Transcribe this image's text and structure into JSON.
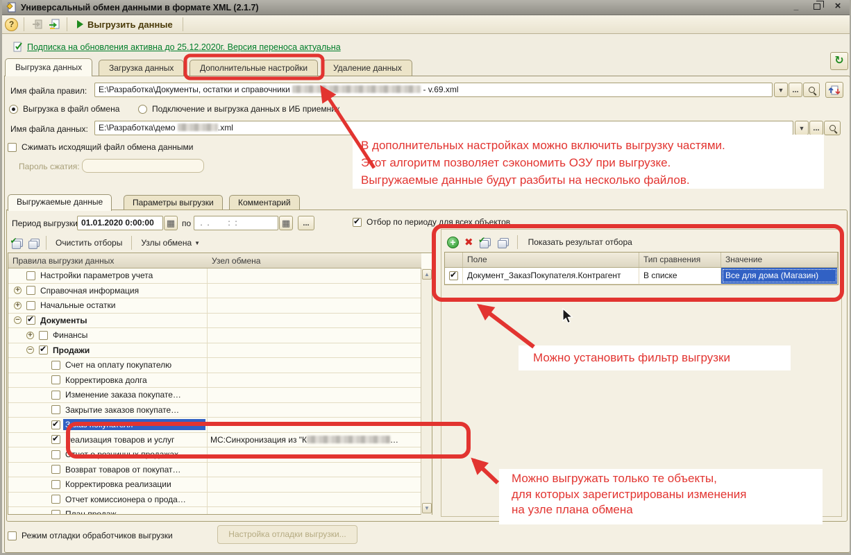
{
  "window": {
    "title": "Универсальный обмен данными в формате XML (2.1.7)",
    "controls": {
      "minimize": "_",
      "close": "×"
    }
  },
  "toolbar": {
    "help": "?",
    "export_label": "Выгрузить данные"
  },
  "subscription": {
    "link": "Подписка на обновления активна до 25.12.2020г. Версия переноса актуальна"
  },
  "tabs": [
    "Выгрузка данных",
    "Загрузка данных",
    "Дополнительные настройки",
    "Удаление данных"
  ],
  "rules_file": {
    "label": "Имя файла правил:",
    "value_prefix": "E:\\Разработка\\Документы, остатки и справочники ",
    "value_suffix": " - v.69.xml"
  },
  "mode": {
    "option1": "Выгрузка в файл обмена",
    "option2": "Подключение и выгрузка данных в ИБ приемник"
  },
  "data_file": {
    "label": "Имя файла данных:",
    "value_prefix": "E:\\Разработка\\демо ",
    "value_suffix": ".xml"
  },
  "compress": {
    "label": "Сжимать исходящий файл обмена данными"
  },
  "password": {
    "label": "Пароль сжатия:",
    "value": ""
  },
  "inner_tabs": [
    "Выгружаемые данные",
    "Параметры выгрузки",
    "Комментарий"
  ],
  "period": {
    "label": "Период выгрузки:",
    "from": "01.01.2020  0:00:00",
    "to_label": "по",
    "to_value": " .  .        :  :",
    "filter_checkbox": "Отбор по периоду для всех объектов"
  },
  "tree_toolbar": {
    "clear": "Очистить отборы",
    "nodes": "Узлы обмена",
    "nodes_arrow": "▼"
  },
  "tree": {
    "headers": [
      "Правила выгрузки данных",
      "Узел обмена"
    ],
    "rows": [
      {
        "label": "Настройки параметров учета",
        "level": 1,
        "checked": false,
        "expander": "none"
      },
      {
        "label": "Справочная информация",
        "level": 1,
        "checked": false,
        "expander": "plus"
      },
      {
        "label": "Начальные остатки",
        "level": 1,
        "checked": false,
        "expander": "plus"
      },
      {
        "label": "Документы",
        "level": 1,
        "checked": true,
        "expander": "minus",
        "bold": true
      },
      {
        "label": "Финансы",
        "level": 2,
        "checked": false,
        "expander": "plus"
      },
      {
        "label": "Продажи",
        "level": 2,
        "checked": true,
        "expander": "minus",
        "bold": true
      },
      {
        "label": "Счет на оплату покупателю",
        "level": 3,
        "checked": false,
        "expander": "none"
      },
      {
        "label": "Корректировка долга",
        "level": 3,
        "checked": false,
        "expander": "none"
      },
      {
        "label": "Изменение заказа покупате…",
        "level": 3,
        "checked": false,
        "expander": "none"
      },
      {
        "label": "Закрытие заказов покупате…",
        "level": 3,
        "checked": false,
        "expander": "none"
      },
      {
        "label": "Заказ покупателя",
        "level": 3,
        "checked": true,
        "expander": "none",
        "selected": true
      },
      {
        "label": "Реализация товаров и услуг",
        "level": 3,
        "checked": true,
        "expander": "none",
        "node_prefix": "МС:Синхронизация из \"К",
        "node_suffix": "…"
      },
      {
        "label": "Отчет о розничных продажах",
        "level": 3,
        "checked": false,
        "expander": "none"
      },
      {
        "label": "Возврат товаров от покупат…",
        "level": 3,
        "checked": false,
        "expander": "none"
      },
      {
        "label": "Корректировка реализации",
        "level": 3,
        "checked": false,
        "expander": "none"
      },
      {
        "label": "Отчет комиссионера о прода…",
        "level": 3,
        "checked": false,
        "expander": "none"
      },
      {
        "label": "План продаж",
        "level": 3,
        "checked": false,
        "expander": "none"
      }
    ]
  },
  "filter": {
    "toolbar_button": "Показать результат отбора",
    "headers": [
      "Поле",
      "Тип сравнения",
      "Значение"
    ],
    "rows": [
      {
        "checked": true,
        "field": "Документ_ЗаказПокупателя.Контрагент",
        "comparison": "В списке",
        "value": "Все для дома (Магазин)"
      }
    ]
  },
  "debug": {
    "checkbox": "Режим отладки обработчиков выгрузки",
    "button": "Настройка отладки выгрузки..."
  },
  "annotations": {
    "color": "#e23430",
    "note1_line1": "В дополнительных настройках можно включить выгрузку частями.",
    "note1_line2": "Этот алгоритм позволяет сэкономить ОЗУ при выгрузке.",
    "note1_line3": "Выгружаемые данные будут разбиты на несколько файлов.",
    "note2": "Можно установить фильтр выгрузки",
    "note3_line1": "Можно выгружать только те объекты,",
    "note3_line2": "для которых зарегистрированы изменения",
    "note3_line3": "на узле плана обмена"
  },
  "icons": {
    "dropdown": "▼",
    "ellipsis": "...",
    "calendar": "▦",
    "refresh": "↻",
    "load_rules": "⇄",
    "scroll_up": "▲",
    "scroll_down": "▼"
  }
}
